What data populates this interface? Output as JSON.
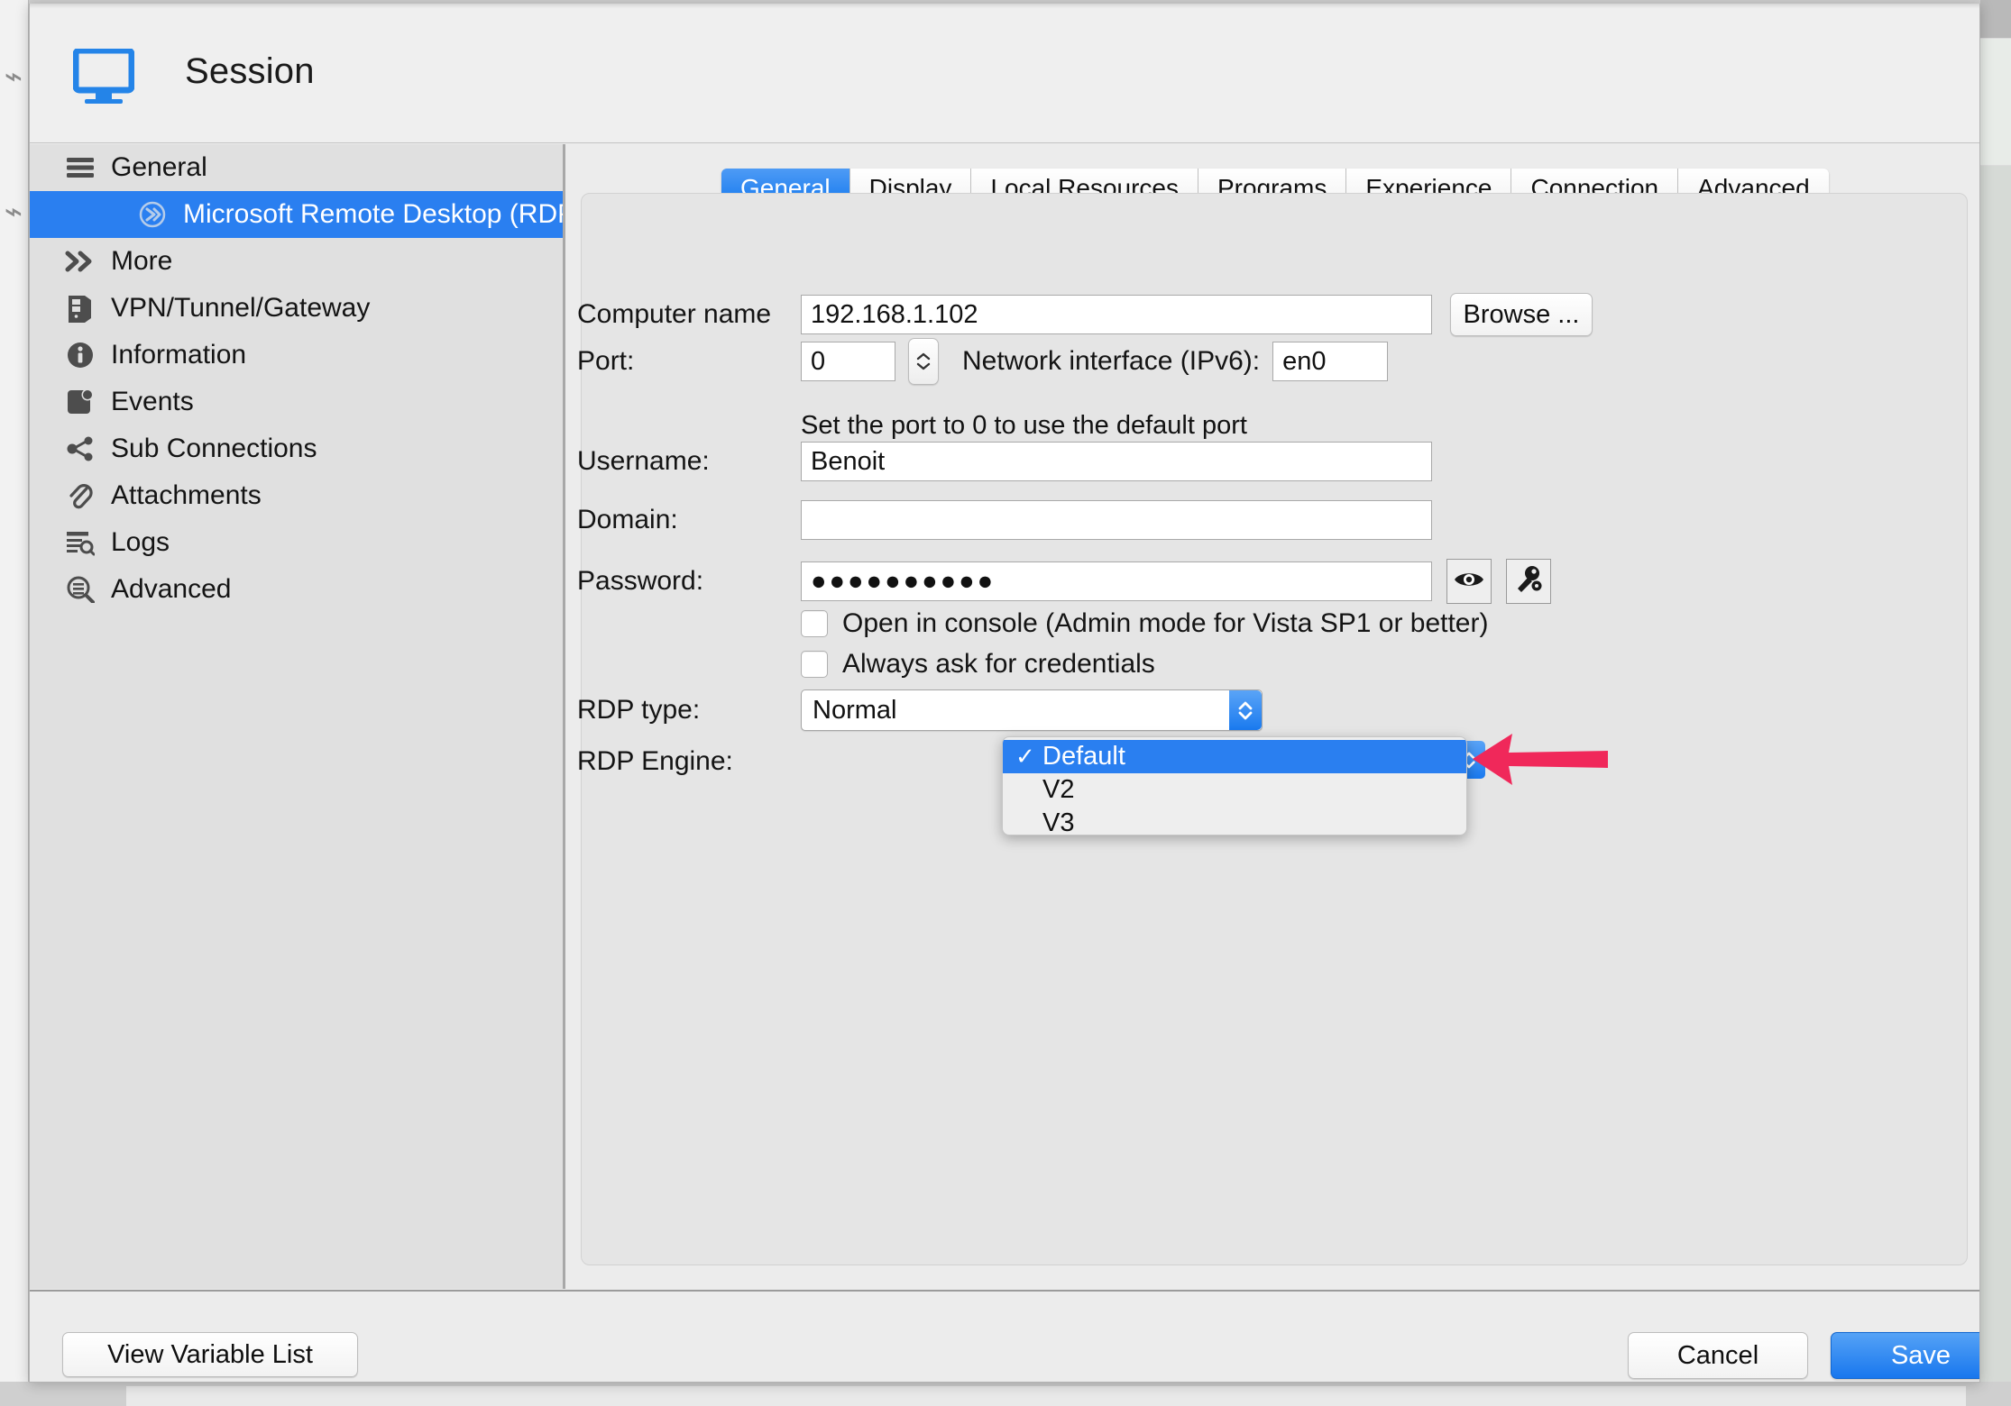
{
  "header": {
    "title": "Session",
    "icon": "monitor-icon"
  },
  "sidebar": {
    "items": [
      {
        "label": "General",
        "icon": "hamburger-icon",
        "selected": false,
        "sub": false
      },
      {
        "label": "Microsoft Remote Desktop (RDP)",
        "icon": "rdp-circle-icon",
        "selected": true,
        "sub": true
      },
      {
        "label": "More",
        "icon": "double-chevron-right-icon",
        "selected": false,
        "sub": false
      },
      {
        "label": "VPN/Tunnel/Gateway",
        "icon": "server-icon",
        "selected": false,
        "sub": false
      },
      {
        "label": "Information",
        "icon": "info-circle-icon",
        "selected": false,
        "sub": false
      },
      {
        "label": "Events",
        "icon": "events-icon",
        "selected": false,
        "sub": false
      },
      {
        "label": "Sub Connections",
        "icon": "share-nodes-icon",
        "selected": false,
        "sub": false
      },
      {
        "label": "Attachments",
        "icon": "paperclip-icon",
        "selected": false,
        "sub": false
      },
      {
        "label": "Logs",
        "icon": "logs-search-icon",
        "selected": false,
        "sub": false
      },
      {
        "label": "Advanced",
        "icon": "magnifier-list-icon",
        "selected": false,
        "sub": false
      }
    ]
  },
  "tabs": [
    {
      "label": "General",
      "active": true
    },
    {
      "label": "Display",
      "active": false
    },
    {
      "label": "Local Resources",
      "active": false
    },
    {
      "label": "Programs",
      "active": false
    },
    {
      "label": "Experience",
      "active": false
    },
    {
      "label": "Connection",
      "active": false
    },
    {
      "label": "Advanced",
      "active": false
    }
  ],
  "form": {
    "computer_name_label": "Computer name",
    "computer_name_value": "192.168.1.102",
    "browse_label": "Browse ...",
    "port_label": "Port:",
    "port_value": "0",
    "network_interface_label": "Network interface (IPv6):",
    "network_interface_value": "en0",
    "port_hint": "Set the port to 0 to use the default port",
    "username_label": "Username:",
    "username_value": "Benoit",
    "domain_label": "Domain:",
    "domain_value": "",
    "password_label": "Password:",
    "password_value": "●●●●●●●●●●",
    "reveal_password_icon": "eye-icon",
    "generate_password_icon": "key-gear-icon",
    "open_in_console_label": "Open in console (Admin mode for Vista SP1 or better)",
    "open_in_console_checked": false,
    "always_ask_label": "Always ask for credentials",
    "always_ask_checked": false,
    "rdp_type_label": "RDP type:",
    "rdp_type_value": "Normal",
    "rdp_engine_label": "RDP Engine:"
  },
  "dropdown": {
    "options": [
      {
        "label": "Default",
        "checked": true,
        "selected": true
      },
      {
        "label": "V2",
        "checked": false,
        "selected": false
      },
      {
        "label": "V3",
        "checked": false,
        "selected": false
      }
    ]
  },
  "annotation": {
    "arrow_color": "#F0285A",
    "arrow_direction": "left",
    "points_at": "rdp-engine-dropdown"
  },
  "footer": {
    "view_variable_list_label": "View Variable List",
    "cancel_label": "Cancel",
    "save_label": "Save"
  },
  "colors": {
    "accent_blue": "#2A7FF0",
    "window_bg": "#ECECEC",
    "sidebar_bg": "#E0E0E0",
    "panel_bg": "#E5E5E5"
  }
}
